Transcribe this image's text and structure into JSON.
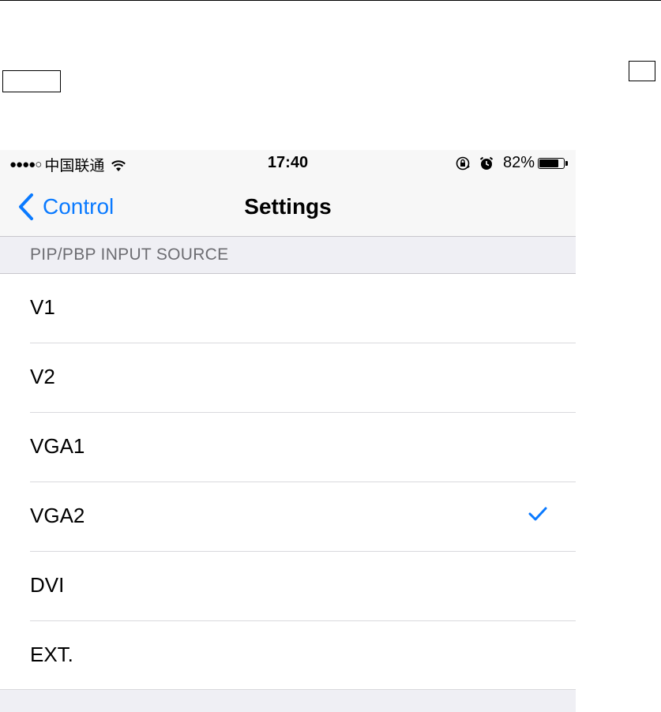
{
  "status_bar": {
    "signal": "●●●●○",
    "carrier": "中国联通",
    "time": "17:40",
    "battery_percent": "82%",
    "battery_level": 0.82
  },
  "nav": {
    "back_label": "Control",
    "title": "Settings"
  },
  "section": {
    "header": "PIP/PBP INPUT SOURCE"
  },
  "options": [
    {
      "label": "V1",
      "selected": false
    },
    {
      "label": "V2",
      "selected": false
    },
    {
      "label": "VGA1",
      "selected": false
    },
    {
      "label": "VGA2",
      "selected": true
    },
    {
      "label": "DVI",
      "selected": false
    },
    {
      "label": "EXT.",
      "selected": false
    }
  ],
  "colors": {
    "accent": "#0a7aff",
    "grouped_background": "#efeff4",
    "bar_background": "#f7f7f7",
    "section_text": "#6d6d72"
  }
}
